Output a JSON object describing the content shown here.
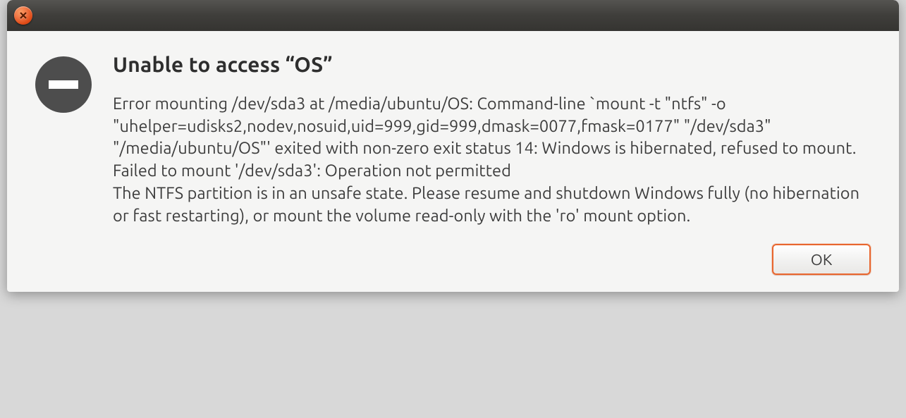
{
  "dialog": {
    "title": "Unable to access “OS”",
    "message": "Error mounting /dev/sda3 at /media/ubuntu/OS: Command-line `mount -t \"ntfs\" -o \"uhelper=udisks2,nodev,nosuid,uid=999,gid=999,dmask=0077,fmask=0177\" \"/dev/sda3\" \"/media/ubuntu/OS\"' exited with non-zero exit status 14: Windows is hibernated, refused to mount.\nFailed to mount '/dev/sda3': Operation not permitted\nThe NTFS partition is in an unsafe state. Please resume and shutdown Windows fully (no hibernation or fast restarting), or mount the volume read-only with the 'ro' mount option.",
    "buttons": {
      "ok": "OK"
    },
    "icon": "error-minus-icon"
  },
  "colors": {
    "titlebar_close": "#e05a1a",
    "accent": "#e8662e"
  }
}
